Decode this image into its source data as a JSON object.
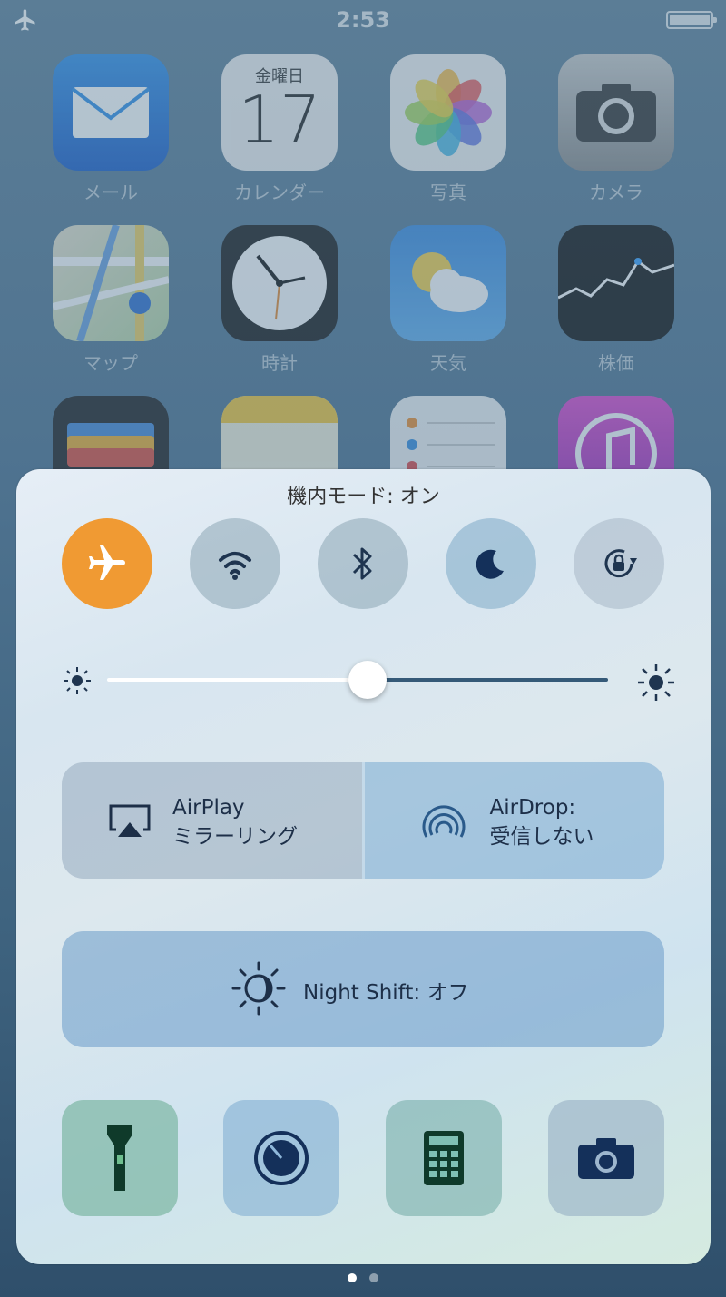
{
  "status_bar": {
    "time": "2:53"
  },
  "home_apps": [
    {
      "label": "メール",
      "icon": "mail-icon"
    },
    {
      "label": "カレンダー",
      "icon": "calendar-icon",
      "weekday": "金曜日",
      "day": "17"
    },
    {
      "label": "写真",
      "icon": "photos-icon"
    },
    {
      "label": "カメラ",
      "icon": "camera-icon"
    },
    {
      "label": "マップ",
      "icon": "maps-icon"
    },
    {
      "label": "時計",
      "icon": "clock-icon"
    },
    {
      "label": "天気",
      "icon": "weather-icon"
    },
    {
      "label": "株価",
      "icon": "stocks-icon"
    },
    {
      "label": "",
      "icon": "wallet-icon"
    },
    {
      "label": "",
      "icon": "notes-icon"
    },
    {
      "label": "",
      "icon": "reminders-icon"
    },
    {
      "label": "",
      "icon": "itunes-icon"
    }
  ],
  "control_center": {
    "title": "機内モード: オン",
    "toggles": [
      {
        "name": "airplane",
        "icon": "airplane-icon",
        "state": "on",
        "color": "#f09a33"
      },
      {
        "name": "wifi",
        "icon": "wifi-icon",
        "state": "off"
      },
      {
        "name": "bluetooth",
        "icon": "bluetooth-icon",
        "state": "off"
      },
      {
        "name": "do-not-disturb",
        "icon": "moon-icon",
        "state": "off"
      },
      {
        "name": "rotation-lock",
        "icon": "rotation-lock-icon",
        "state": "off"
      }
    ],
    "brightness": {
      "level": 0.52
    },
    "airplay": {
      "line1": "AirPlay",
      "line2": "ミラーリング"
    },
    "airdrop": {
      "line1": "AirDrop:",
      "line2": "受信しない"
    },
    "night_shift": {
      "label": "Night Shift: オフ"
    },
    "tools": [
      {
        "name": "flashlight",
        "icon": "flashlight-icon"
      },
      {
        "name": "timer",
        "icon": "timer-icon"
      },
      {
        "name": "calculator",
        "icon": "calculator-icon"
      },
      {
        "name": "camera",
        "icon": "camera-icon"
      }
    ]
  },
  "page_dots": {
    "count": 2,
    "active": 0
  }
}
